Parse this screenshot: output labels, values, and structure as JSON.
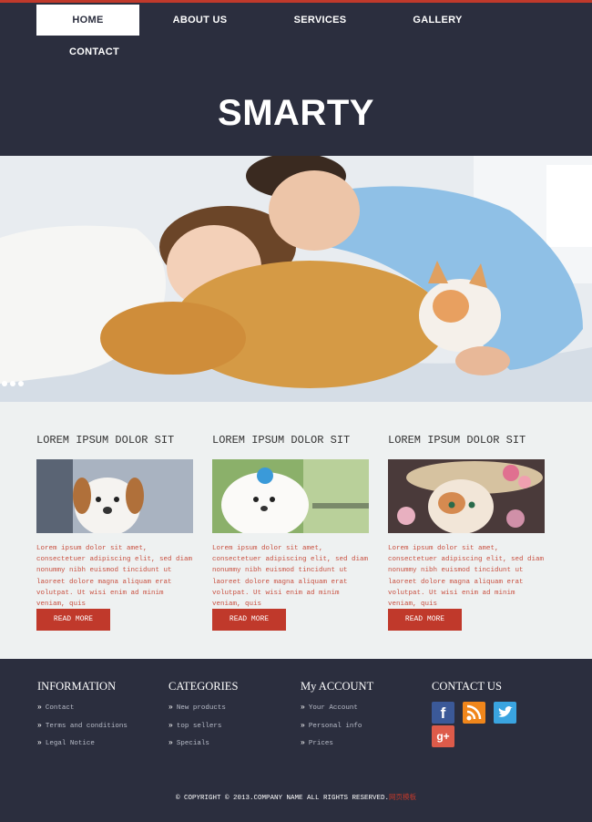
{
  "nav": {
    "items": [
      {
        "label": "HOME",
        "active": true
      },
      {
        "label": "ABOUT US"
      },
      {
        "label": "SERVICES"
      },
      {
        "label": "GALLERY"
      },
      {
        "label": "CONTACT"
      }
    ]
  },
  "brand": {
    "title": "SMARTY"
  },
  "slider": {
    "dots": 3
  },
  "features": [
    {
      "title": "LOREM IPSUM DOLOR SIT",
      "image": "dog-photo",
      "text": "Lorem ipsum dolor sit amet, consectetuer adipiscing elit, sed diam nonummy nibh euismod tincidunt ut laoreet dolore magna aliquam erat volutpat. Ut wisi enim ad minim veniam, quis",
      "button": "READ MORE"
    },
    {
      "title": "LOREM IPSUM DOLOR SIT",
      "image": "puppy-photo",
      "text": "Lorem ipsum dolor sit amet, consectetuer adipiscing elit, sed diam nonummy nibh euismod tincidunt ut laoreet dolore magna aliquam erat volutpat. Ut wisi enim ad minim veniam, quis",
      "button": "READ MORE"
    },
    {
      "title": "LOREM IPSUM DOLOR SIT",
      "image": "kitten-photo",
      "text": "Lorem ipsum dolor sit amet, consectetuer adipiscing elit, sed diam nonummy nibh euismod tincidunt ut laoreet dolore magna aliquam erat volutpat. Ut wisi enim ad minim veniam, quis",
      "button": "READ MORE"
    }
  ],
  "footer": {
    "columns": [
      {
        "heading": "INFORMATION",
        "links": [
          "Contact",
          "Terms and conditions",
          "Legal Notice"
        ]
      },
      {
        "heading": "CATEGORIES",
        "links": [
          "New products",
          "top sellers",
          "Specials"
        ]
      },
      {
        "heading": "My ACCOUNT",
        "links": [
          "Your Account",
          "Personal info",
          "Prices"
        ]
      },
      {
        "heading": "CONTACT US",
        "social": [
          "facebook",
          "rss",
          "twitter",
          "google-plus"
        ]
      }
    ],
    "copyright": {
      "text": "© COPYRIGHT © 2013.COMPANY NAME ALL RIGHTS RESERVED.",
      "link": "网页模板"
    }
  },
  "colors": {
    "accent": "#c0392b",
    "dark": "#2b2e3e",
    "content_bg": "#eef1f1"
  }
}
